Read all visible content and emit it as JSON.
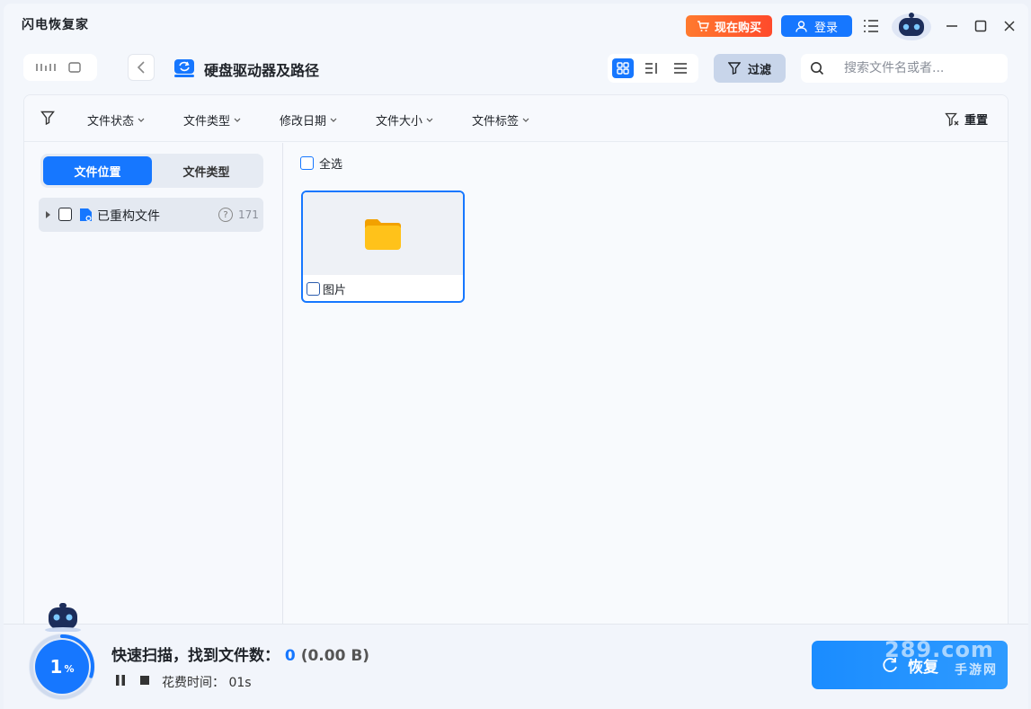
{
  "titlebar": {
    "app_title": "闪电恢复家",
    "buy_label": "现在购买",
    "login_label": "登录"
  },
  "toolbar": {
    "path_title": "硬盘驱动器及路径",
    "filter_label": "过滤",
    "search_placeholder": "搜索文件名或者..."
  },
  "filter_bar": {
    "items": [
      "文件状态",
      "文件类型",
      "修改日期",
      "文件大小",
      "文件标签"
    ],
    "reset_label": "重置"
  },
  "left_pane": {
    "tabs": [
      "文件位置",
      "文件类型"
    ],
    "active_tab": 0,
    "tree": [
      {
        "label": "已重构文件",
        "count": "171"
      }
    ]
  },
  "right_pane": {
    "select_all_label": "全选",
    "items": [
      {
        "name": "图片",
        "icon": "folder-icon"
      }
    ]
  },
  "status": {
    "progress_value": "1",
    "progress_unit": "%",
    "progress_fraction": 0.01,
    "scan_label": "快速扫描，找到文件数：",
    "found_count": "0",
    "found_size": "(0.00 B)",
    "elapsed_label": "花费时间：",
    "elapsed_value": "01s",
    "recover_label": "恢复"
  },
  "watermark": {
    "main": "289.com",
    "sub": "手游网"
  },
  "colors": {
    "accent": "#1677ff",
    "buy": "#ff5a2b",
    "folder": "#ffb400"
  }
}
